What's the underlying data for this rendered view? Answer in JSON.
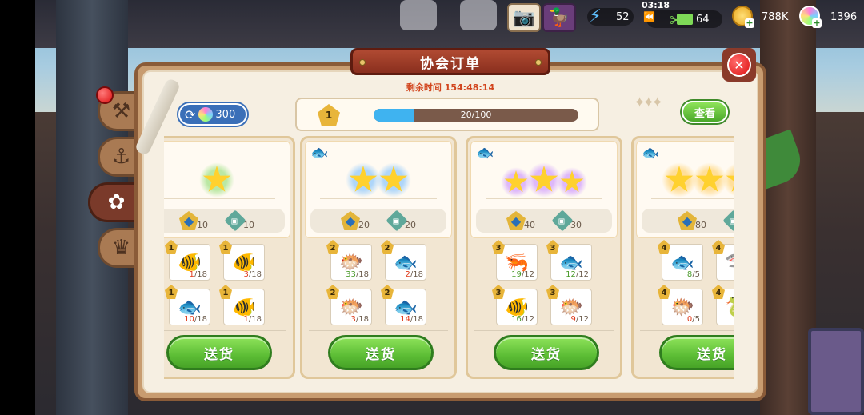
{
  "hud": {
    "energy": "52",
    "food_timer": "03:18",
    "food": "64",
    "coins": "788K",
    "gems": "1396"
  },
  "panel": {
    "title": "协会订单",
    "close_glyph": "✕",
    "timer": "剩余时间 154:48:14",
    "refresh_cost": "300",
    "level": "1",
    "progress_text": "20/100",
    "progress_fraction": 0.2,
    "view_label": "查看"
  },
  "cards": [
    {
      "stars": 1,
      "glow": "green",
      "has_fish_mark": false,
      "rewards": [
        "10",
        "10"
      ],
      "items": [
        {
          "tier": "1",
          "have": "1",
          "need": "/18",
          "icon": "clownfish"
        },
        {
          "tier": "1",
          "have": "3",
          "need": "/18",
          "icon": "clownfish"
        },
        {
          "tier": "1",
          "have": "10",
          "need": "/18",
          "icon": "blue-fish"
        },
        {
          "tier": "1",
          "have": "1",
          "need": "/18",
          "icon": "red-fish"
        }
      ],
      "deliver_label": "送货"
    },
    {
      "stars": 2,
      "glow": "blue",
      "has_fish_mark": true,
      "rewards": [
        "20",
        "20"
      ],
      "items": [
        {
          "tier": "2",
          "have": "33",
          "need": "/18",
          "icon": "flatfish",
          "ok": true
        },
        {
          "tier": "2",
          "have": "2",
          "need": "/18",
          "icon": "grey-fish"
        },
        {
          "tier": "2",
          "have": "3",
          "need": "/18",
          "icon": "yellow-fish"
        },
        {
          "tier": "2",
          "have": "14",
          "need": "/18",
          "icon": "salmon"
        }
      ],
      "deliver_label": "送货"
    },
    {
      "stars": 3,
      "glow": "purple",
      "has_fish_mark": true,
      "rewards": [
        "40",
        "30"
      ],
      "items": [
        {
          "tier": "3",
          "have": "19",
          "need": "/12",
          "icon": "isopod",
          "ok": true
        },
        {
          "tier": "3",
          "have": "12",
          "need": "/12",
          "icon": "olive-fish",
          "ok": true
        },
        {
          "tier": "3",
          "have": "16",
          "need": "/12",
          "icon": "parrotfish",
          "ok": true
        },
        {
          "tier": "3",
          "have": "9",
          "need": "/12",
          "icon": "spotted-fish"
        }
      ],
      "deliver_label": "送货"
    },
    {
      "stars": 3,
      "glow": "gold",
      "has_fish_mark": true,
      "rewards": [
        "80",
        ""
      ],
      "items": [
        {
          "tier": "4",
          "have": "8",
          "need": "/5",
          "icon": "tuna",
          "ok": true
        },
        {
          "tier": "4",
          "have": "",
          "need": "",
          "icon": "shark"
        },
        {
          "tier": "4",
          "have": "0",
          "need": "/5",
          "icon": "grouper"
        },
        {
          "tier": "4",
          "have": "",
          "need": "",
          "icon": "eel"
        }
      ],
      "deliver_label": "送货"
    }
  ]
}
